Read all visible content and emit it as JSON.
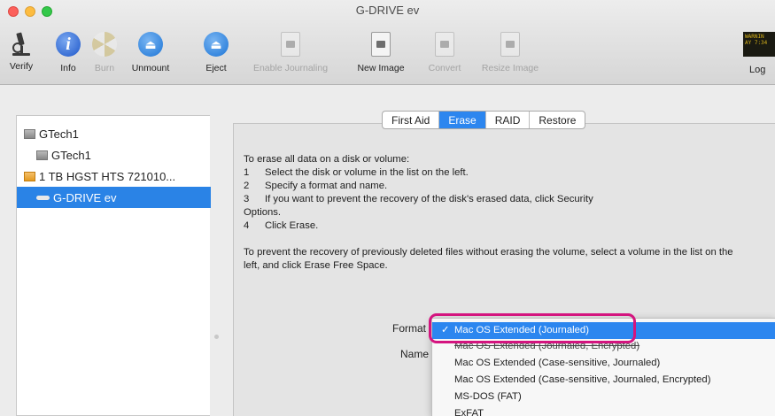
{
  "window": {
    "title": "G-DRIVE ev"
  },
  "toolbar": {
    "items": [
      {
        "label": "Verify",
        "icon": "microscope-icon",
        "enabled": true
      },
      {
        "label": "Info",
        "icon": "info-icon",
        "enabled": true
      },
      {
        "label": "Burn",
        "icon": "burn-icon",
        "enabled": false
      },
      {
        "label": "Unmount",
        "icon": "unmount-icon",
        "enabled": true
      },
      {
        "label": "Eject",
        "icon": "eject-icon",
        "enabled": true
      },
      {
        "label": "Enable Journaling",
        "icon": "journal-icon",
        "enabled": false
      },
      {
        "label": "New Image",
        "icon": "new-image-icon",
        "enabled": true
      },
      {
        "label": "Convert",
        "icon": "convert-icon",
        "enabled": false
      },
      {
        "label": "Resize Image",
        "icon": "resize-image-icon",
        "enabled": false
      }
    ],
    "log_label": "Log",
    "log_badge_text": "WARNIN\nAY 7:34"
  },
  "sidebar": {
    "items": [
      {
        "label": "GTech1",
        "type": "disk",
        "selected": false
      },
      {
        "label": "GTech1",
        "type": "volume",
        "selected": false
      },
      {
        "label": "1 TB HGST HTS 721010...",
        "type": "disk-external",
        "selected": false
      },
      {
        "label": "G-DRIVE ev",
        "type": "volume",
        "selected": true
      }
    ]
  },
  "tabs": [
    {
      "label": "First Aid",
      "active": false
    },
    {
      "label": "Erase",
      "active": true
    },
    {
      "label": "RAID",
      "active": false
    },
    {
      "label": "Restore",
      "active": false
    }
  ],
  "instructions": {
    "intro": "To erase all data on a disk or volume:",
    "steps": [
      {
        "num": "1",
        "text": "Select the disk or volume in the list on the left."
      },
      {
        "num": "2",
        "text": "Specify a format and name."
      },
      {
        "num": "3",
        "text": "If you want to prevent the recovery of the disk's erased data, click Security"
      },
      {
        "num": "",
        "text": "Options."
      },
      {
        "num": "4",
        "text": "Click Erase."
      }
    ],
    "note": "To prevent the recovery of previously deleted files without erasing the volume, select a volume in the list on the left, and click Erase Free Space."
  },
  "form": {
    "format_label": "Format",
    "name_label": "Name"
  },
  "format_menu": {
    "check": "✓",
    "options": [
      {
        "label": "Mac OS Extended (Journaled)",
        "selected": true
      },
      {
        "label": "Mac OS Extended (Journaled, Encrypted)",
        "selected": false
      },
      {
        "label": "Mac OS Extended (Case-sensitive, Journaled)",
        "selected": false
      },
      {
        "label": "Mac OS Extended (Case-sensitive, Journaled, Encrypted)",
        "selected": false
      },
      {
        "label": "MS-DOS (FAT)",
        "selected": false
      },
      {
        "label": "ExFAT",
        "selected": false
      }
    ]
  },
  "colors": {
    "selection": "#2a83e6",
    "highlight_ring": "#d4147f"
  }
}
